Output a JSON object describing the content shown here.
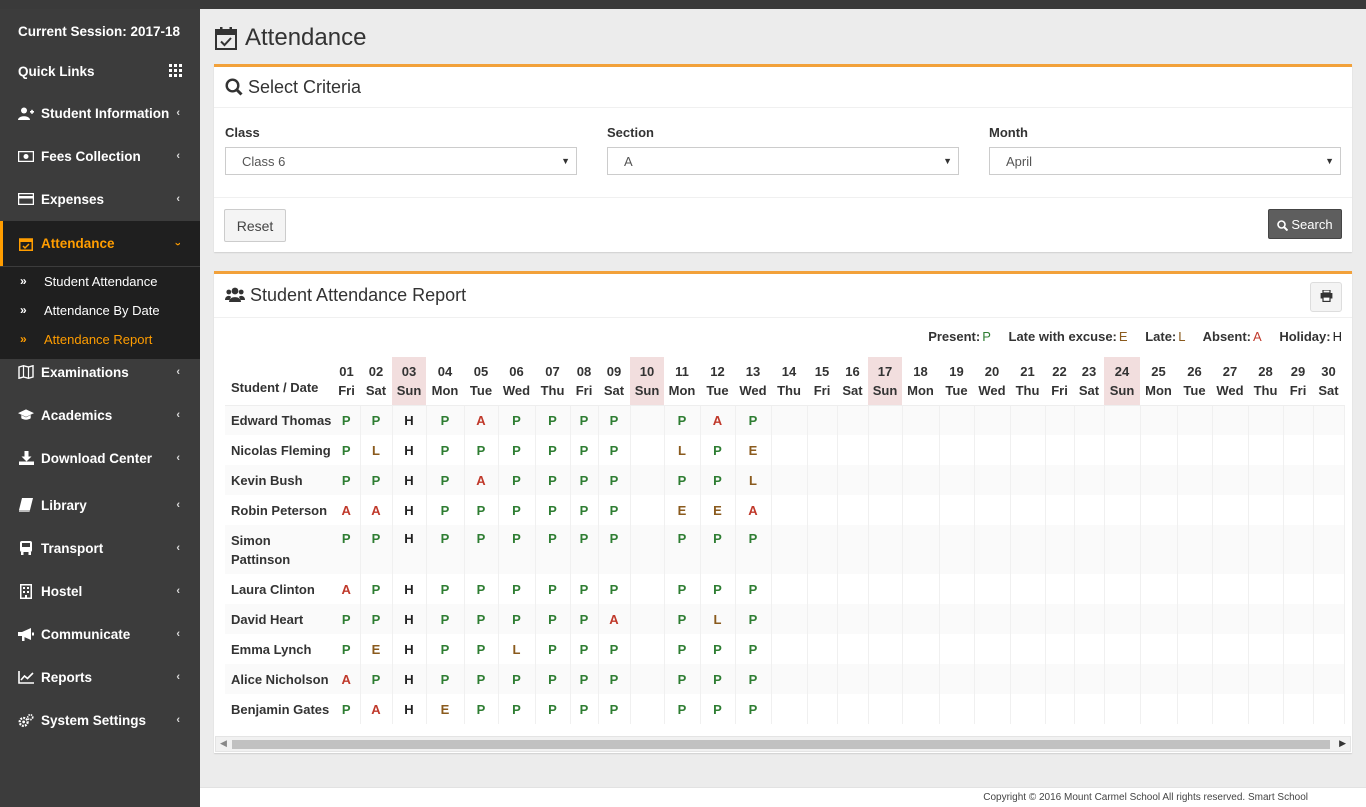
{
  "sidebar": {
    "session": "Current Session: 2017-18",
    "quick_links": "Quick Links",
    "items": [
      {
        "label": "Student Information",
        "icon": "user-plus-icon"
      },
      {
        "label": "Fees Collection",
        "icon": "money-icon"
      },
      {
        "label": "Expenses",
        "icon": "credit-card-icon"
      },
      {
        "label": "Attendance",
        "icon": "calendar-check-icon"
      },
      {
        "label": "Examinations",
        "icon": "map-icon"
      },
      {
        "label": "Academics",
        "icon": "graduation-cap-icon"
      },
      {
        "label": "Download Center",
        "icon": "download-icon"
      },
      {
        "label": "Library",
        "icon": "book-icon"
      },
      {
        "label": "Transport",
        "icon": "bus-icon"
      },
      {
        "label": "Hostel",
        "icon": "building-icon"
      },
      {
        "label": "Communicate",
        "icon": "bullhorn-icon"
      },
      {
        "label": "Reports",
        "icon": "line-chart-icon"
      },
      {
        "label": "System Settings",
        "icon": "cogs-icon"
      }
    ],
    "sub_items": [
      "Student Attendance",
      "Attendance By Date",
      "Attendance Report"
    ]
  },
  "page": {
    "title": "Attendance"
  },
  "criteria": {
    "title": "Select Criteria",
    "class_label": "Class",
    "class_value": "Class 6",
    "section_label": "Section",
    "section_value": "A",
    "month_label": "Month",
    "month_value": "April",
    "reset": "Reset",
    "search": "Search"
  },
  "report": {
    "title": "Student Attendance Report",
    "legend": {
      "present_label": "Present:",
      "present_value": "P",
      "late_excuse_label": "Late with excuse:",
      "late_excuse_value": "E",
      "late_label": "Late:",
      "late_value": "L",
      "absent_label": "Absent:",
      "absent_value": "A",
      "holiday_label": "Holiday:",
      "holiday_value": "H"
    },
    "col_header": "Student / Date",
    "days": [
      {
        "d": "01",
        "w": "Fri"
      },
      {
        "d": "02",
        "w": "Sat"
      },
      {
        "d": "03",
        "w": "Sun"
      },
      {
        "d": "04",
        "w": "Mon"
      },
      {
        "d": "05",
        "w": "Tue"
      },
      {
        "d": "06",
        "w": "Wed"
      },
      {
        "d": "07",
        "w": "Thu"
      },
      {
        "d": "08",
        "w": "Fri"
      },
      {
        "d": "09",
        "w": "Sat"
      },
      {
        "d": "10",
        "w": "Sun"
      },
      {
        "d": "11",
        "w": "Mon"
      },
      {
        "d": "12",
        "w": "Tue"
      },
      {
        "d": "13",
        "w": "Wed"
      },
      {
        "d": "14",
        "w": "Thu"
      },
      {
        "d": "15",
        "w": "Fri"
      },
      {
        "d": "16",
        "w": "Sat"
      },
      {
        "d": "17",
        "w": "Sun"
      },
      {
        "d": "18",
        "w": "Mon"
      },
      {
        "d": "19",
        "w": "Tue"
      },
      {
        "d": "20",
        "w": "Wed"
      },
      {
        "d": "21",
        "w": "Thu"
      },
      {
        "d": "22",
        "w": "Fri"
      },
      {
        "d": "23",
        "w": "Sat"
      },
      {
        "d": "24",
        "w": "Sun"
      },
      {
        "d": "25",
        "w": "Mon"
      },
      {
        "d": "26",
        "w": "Tue"
      },
      {
        "d": "27",
        "w": "Wed"
      },
      {
        "d": "28",
        "w": "Thu"
      },
      {
        "d": "29",
        "w": "Fri"
      },
      {
        "d": "30",
        "w": "Sat"
      }
    ],
    "students": [
      {
        "name": "Edward Thomas",
        "marks": [
          "P",
          "P",
          "H",
          "P",
          "A",
          "P",
          "P",
          "P",
          "P",
          "",
          "P",
          "A",
          "P"
        ]
      },
      {
        "name": "Nicolas Fleming",
        "marks": [
          "P",
          "L",
          "H",
          "P",
          "P",
          "P",
          "P",
          "P",
          "P",
          "",
          "L",
          "P",
          "E"
        ]
      },
      {
        "name": "Kevin Bush",
        "marks": [
          "P",
          "P",
          "H",
          "P",
          "A",
          "P",
          "P",
          "P",
          "P",
          "",
          "P",
          "P",
          "L"
        ]
      },
      {
        "name": "Robin Peterson",
        "marks": [
          "A",
          "A",
          "H",
          "P",
          "P",
          "P",
          "P",
          "P",
          "P",
          "",
          "E",
          "E",
          "A"
        ]
      },
      {
        "name": "Simon Pattinson",
        "marks": [
          "P",
          "P",
          "H",
          "P",
          "P",
          "P",
          "P",
          "P",
          "P",
          "",
          "P",
          "P",
          "P"
        ]
      },
      {
        "name": "Laura Clinton",
        "marks": [
          "A",
          "P",
          "H",
          "P",
          "P",
          "P",
          "P",
          "P",
          "P",
          "",
          "P",
          "P",
          "P"
        ]
      },
      {
        "name": "David Heart",
        "marks": [
          "P",
          "P",
          "H",
          "P",
          "P",
          "P",
          "P",
          "P",
          "A",
          "",
          "P",
          "L",
          "P"
        ]
      },
      {
        "name": "Emma Lynch",
        "marks": [
          "P",
          "E",
          "H",
          "P",
          "P",
          "L",
          "P",
          "P",
          "P",
          "",
          "P",
          "P",
          "P"
        ]
      },
      {
        "name": "Alice Nicholson",
        "marks": [
          "A",
          "P",
          "H",
          "P",
          "P",
          "P",
          "P",
          "P",
          "P",
          "",
          "P",
          "P",
          "P"
        ]
      },
      {
        "name": "Benjamin Gates",
        "marks": [
          "P",
          "A",
          "H",
          "E",
          "P",
          "P",
          "P",
          "P",
          "P",
          "",
          "P",
          "P",
          "P"
        ]
      }
    ]
  },
  "footer": {
    "text": "Copyright © 2016 Mount Carmel School All rights reserved. Smart School"
  },
  "colors": {
    "accent": "#f2a13a",
    "sidebar": "#3c3c3c",
    "active_text": "#ff9d00",
    "present": "#2e7d32",
    "absent": "#c0392b",
    "sunday_bg": "#f2dede"
  }
}
